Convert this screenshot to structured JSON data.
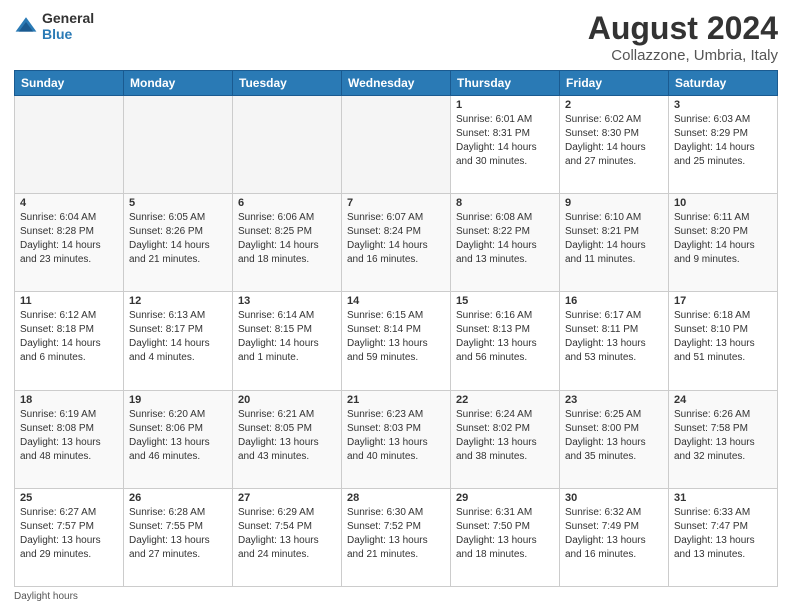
{
  "logo": {
    "line1": "General",
    "line2": "Blue"
  },
  "title": "August 2024",
  "subtitle": "Collazzone, Umbria, Italy",
  "days_header": [
    "Sunday",
    "Monday",
    "Tuesday",
    "Wednesday",
    "Thursday",
    "Friday",
    "Saturday"
  ],
  "weeks": [
    [
      {
        "day": "",
        "info": ""
      },
      {
        "day": "",
        "info": ""
      },
      {
        "day": "",
        "info": ""
      },
      {
        "day": "",
        "info": ""
      },
      {
        "day": "1",
        "info": "Sunrise: 6:01 AM\nSunset: 8:31 PM\nDaylight: 14 hours and 30 minutes."
      },
      {
        "day": "2",
        "info": "Sunrise: 6:02 AM\nSunset: 8:30 PM\nDaylight: 14 hours and 27 minutes."
      },
      {
        "day": "3",
        "info": "Sunrise: 6:03 AM\nSunset: 8:29 PM\nDaylight: 14 hours and 25 minutes."
      }
    ],
    [
      {
        "day": "4",
        "info": "Sunrise: 6:04 AM\nSunset: 8:28 PM\nDaylight: 14 hours and 23 minutes."
      },
      {
        "day": "5",
        "info": "Sunrise: 6:05 AM\nSunset: 8:26 PM\nDaylight: 14 hours and 21 minutes."
      },
      {
        "day": "6",
        "info": "Sunrise: 6:06 AM\nSunset: 8:25 PM\nDaylight: 14 hours and 18 minutes."
      },
      {
        "day": "7",
        "info": "Sunrise: 6:07 AM\nSunset: 8:24 PM\nDaylight: 14 hours and 16 minutes."
      },
      {
        "day": "8",
        "info": "Sunrise: 6:08 AM\nSunset: 8:22 PM\nDaylight: 14 hours and 13 minutes."
      },
      {
        "day": "9",
        "info": "Sunrise: 6:10 AM\nSunset: 8:21 PM\nDaylight: 14 hours and 11 minutes."
      },
      {
        "day": "10",
        "info": "Sunrise: 6:11 AM\nSunset: 8:20 PM\nDaylight: 14 hours and 9 minutes."
      }
    ],
    [
      {
        "day": "11",
        "info": "Sunrise: 6:12 AM\nSunset: 8:18 PM\nDaylight: 14 hours and 6 minutes."
      },
      {
        "day": "12",
        "info": "Sunrise: 6:13 AM\nSunset: 8:17 PM\nDaylight: 14 hours and 4 minutes."
      },
      {
        "day": "13",
        "info": "Sunrise: 6:14 AM\nSunset: 8:15 PM\nDaylight: 14 hours and 1 minute."
      },
      {
        "day": "14",
        "info": "Sunrise: 6:15 AM\nSunset: 8:14 PM\nDaylight: 13 hours and 59 minutes."
      },
      {
        "day": "15",
        "info": "Sunrise: 6:16 AM\nSunset: 8:13 PM\nDaylight: 13 hours and 56 minutes."
      },
      {
        "day": "16",
        "info": "Sunrise: 6:17 AM\nSunset: 8:11 PM\nDaylight: 13 hours and 53 minutes."
      },
      {
        "day": "17",
        "info": "Sunrise: 6:18 AM\nSunset: 8:10 PM\nDaylight: 13 hours and 51 minutes."
      }
    ],
    [
      {
        "day": "18",
        "info": "Sunrise: 6:19 AM\nSunset: 8:08 PM\nDaylight: 13 hours and 48 minutes."
      },
      {
        "day": "19",
        "info": "Sunrise: 6:20 AM\nSunset: 8:06 PM\nDaylight: 13 hours and 46 minutes."
      },
      {
        "day": "20",
        "info": "Sunrise: 6:21 AM\nSunset: 8:05 PM\nDaylight: 13 hours and 43 minutes."
      },
      {
        "day": "21",
        "info": "Sunrise: 6:23 AM\nSunset: 8:03 PM\nDaylight: 13 hours and 40 minutes."
      },
      {
        "day": "22",
        "info": "Sunrise: 6:24 AM\nSunset: 8:02 PM\nDaylight: 13 hours and 38 minutes."
      },
      {
        "day": "23",
        "info": "Sunrise: 6:25 AM\nSunset: 8:00 PM\nDaylight: 13 hours and 35 minutes."
      },
      {
        "day": "24",
        "info": "Sunrise: 6:26 AM\nSunset: 7:58 PM\nDaylight: 13 hours and 32 minutes."
      }
    ],
    [
      {
        "day": "25",
        "info": "Sunrise: 6:27 AM\nSunset: 7:57 PM\nDaylight: 13 hours and 29 minutes."
      },
      {
        "day": "26",
        "info": "Sunrise: 6:28 AM\nSunset: 7:55 PM\nDaylight: 13 hours and 27 minutes."
      },
      {
        "day": "27",
        "info": "Sunrise: 6:29 AM\nSunset: 7:54 PM\nDaylight: 13 hours and 24 minutes."
      },
      {
        "day": "28",
        "info": "Sunrise: 6:30 AM\nSunset: 7:52 PM\nDaylight: 13 hours and 21 minutes."
      },
      {
        "day": "29",
        "info": "Sunrise: 6:31 AM\nSunset: 7:50 PM\nDaylight: 13 hours and 18 minutes."
      },
      {
        "day": "30",
        "info": "Sunrise: 6:32 AM\nSunset: 7:49 PM\nDaylight: 13 hours and 16 minutes."
      },
      {
        "day": "31",
        "info": "Sunrise: 6:33 AM\nSunset: 7:47 PM\nDaylight: 13 hours and 13 minutes."
      }
    ]
  ],
  "footer": "Daylight hours"
}
